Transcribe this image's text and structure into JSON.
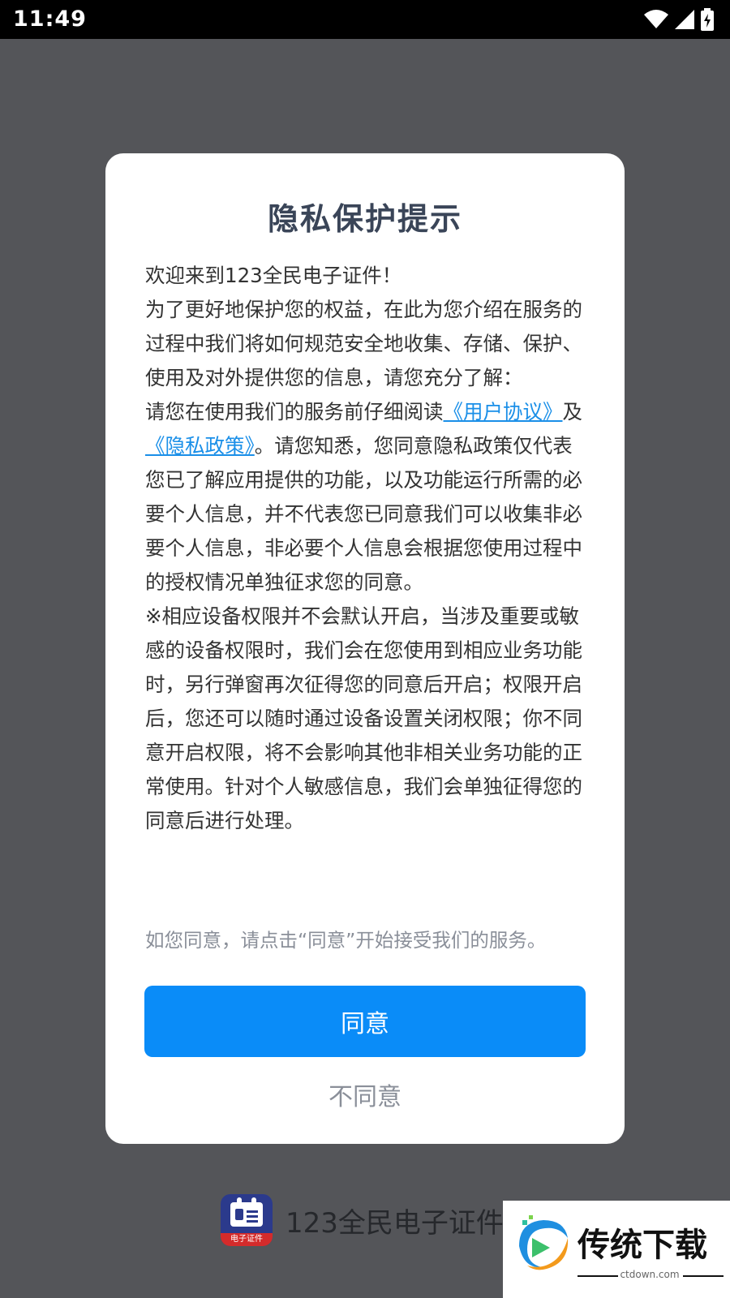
{
  "status_bar": {
    "time": "11:49"
  },
  "dialog": {
    "title": "隐私保护提示",
    "welcome": "欢迎来到123全民电子证件！",
    "intro": "为了更好地保护您的权益，在此为您介绍在服务的过程中我们将如何规范安全地收集、存储、保护、使用及对外提供您的信息，请您充分了解：",
    "read_prefix": "请您在使用我们的服务前仔细阅读",
    "user_agreement_link": "《用户协议》",
    "and": "及",
    "privacy_policy_link": "《隐私政策》",
    "read_suffix": "。请您知悉，您同意隐私政策仅代表您已了解应用提供的功能，以及功能运行所需的必要个人信息，并不代表您已同意我们可以收集非必要个人信息，非必要个人信息会根据您使用过程中的授权情况单独征求您的同意。",
    "permissions_note": "※相应设备权限并不会默认开启，当涉及重要或敏感的设备权限时，我们会在您使用到相应业务功能时，另行弹窗再次征得您的同意后开启；权限开启后，您还可以随时通过设备设置关闭权限；你不同意开启权限，将不会影响其他非相关业务功能的正常使用。针对个人敏感信息，我们会单独征得您的同意后进行处理。",
    "hint": "如您同意，请点击“同意”开始接受我们的服务。",
    "agree_label": "同意",
    "disagree_label": "不同意"
  },
  "app": {
    "name": "123全民电子证件",
    "logo_caption": "电子证件"
  },
  "watermark": {
    "text": "传统下载",
    "sub": "ctdown.com"
  },
  "colors": {
    "accent": "#0a8cf8",
    "link": "#1a8fe8",
    "overlay": "#545559",
    "title": "#3a4558"
  }
}
